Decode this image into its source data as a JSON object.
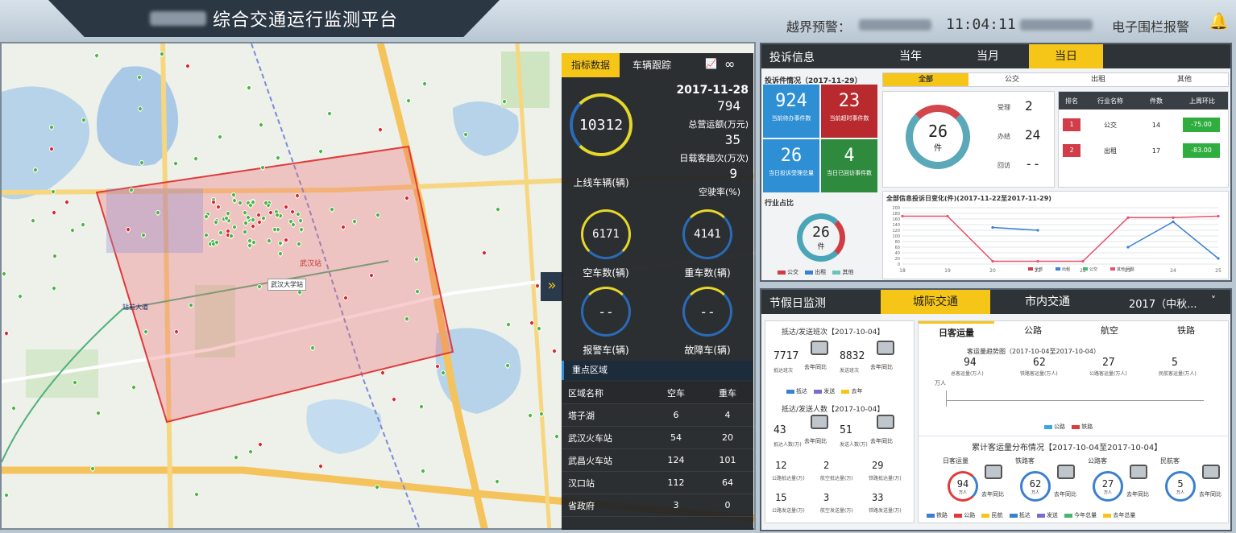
{
  "header": {
    "title": "综合交通运行监测平台",
    "alert_label": "越界预警：",
    "time": "11:04:11",
    "fence_alert": "电子围栏报警"
  },
  "map": {
    "labels": [
      "武汉站",
      "武汉大学站",
      "站前大道",
      "汉口站"
    ],
    "expand_icon": "chevrons-right-icon"
  },
  "overlay": {
    "tabs": [
      "指标数据",
      "车辆跟踪"
    ],
    "date": "2017-11-28",
    "online_vehicles": {
      "value": "10312",
      "label": "上线车辆(辆)"
    },
    "revenue": {
      "value": "794",
      "label": "总营运额(万元)"
    },
    "daily_passengers": {
      "value": "35",
      "label": "日载客趟次(万次)"
    },
    "empty_rate": {
      "value": "9",
      "label": "空驶率(%)"
    },
    "empty_cars": {
      "value": "6171",
      "label": "空车数(辆)"
    },
    "heavy_cars": {
      "value": "4141",
      "label": "重车数(辆)"
    },
    "alarm_cars": {
      "value": "--",
      "label": "报警车(辆)"
    },
    "fault_cars": {
      "value": "--",
      "label": "故障车(辆)"
    },
    "zone_title": "重点区域",
    "zone_headers": [
      "区域名称",
      "空车",
      "重车"
    ],
    "zones": [
      {
        "name": "塔子湖",
        "empty": "6",
        "heavy": "4"
      },
      {
        "name": "武汉火车站",
        "empty": "54",
        "heavy": "20"
      },
      {
        "name": "武昌火车站",
        "empty": "124",
        "heavy": "101"
      },
      {
        "name": "汉口站",
        "empty": "112",
        "heavy": "64"
      },
      {
        "name": "省政府",
        "empty": "3",
        "heavy": "0"
      }
    ]
  },
  "complaints": {
    "title": "投诉信息",
    "period_tabs": [
      "当年",
      "当月",
      "当日"
    ],
    "summary_title": "投诉件情况（2017-11-29）",
    "tiles": [
      {
        "value": "924",
        "label": "当前待办事件数",
        "color": "#2e8fd4"
      },
      {
        "value": "23",
        "label": "当前超时事件数",
        "color": "#b92a2e"
      },
      {
        "value": "26",
        "label": "当日投诉受理总量",
        "color": "#2e8fd4"
      },
      {
        "value": "4",
        "label": "当日已回访事件数",
        "color": "#2e8b3e"
      }
    ],
    "filter_tabs": [
      "全部",
      "公交",
      "出租",
      "其他"
    ],
    "ring": {
      "value": "26",
      "unit": "件"
    },
    "counts": [
      {
        "label": "受理",
        "value": "2"
      },
      {
        "label": "办结",
        "value": "24"
      },
      {
        "label": "回访",
        "value": "--"
      }
    ],
    "rank_headers": [
      "排名",
      "行业名称",
      "件数",
      "上周环比"
    ],
    "ranks": [
      {
        "rank": "1",
        "name": "公交",
        "count": "14",
        "change": "-75.00"
      },
      {
        "rank": "2",
        "name": "出租",
        "count": "17",
        "change": "-83.00"
      }
    ],
    "industry_title": "行业占比",
    "industry_ring": {
      "value": "26",
      "unit": "件"
    },
    "industry_legend": [
      "公交",
      "出租",
      "其他"
    ],
    "chart_title": "全部信息投诉日变化(件)(2017-11-22至2017-11-29)",
    "chart_legend": [
      "全部",
      "出租",
      "公交",
      "其他/问题"
    ]
  },
  "chart_data": {
    "type": "line",
    "x": [
      "18",
      "19",
      "20",
      "21",
      "22",
      "23",
      "24",
      "25"
    ],
    "ylim": [
      0,
      200
    ],
    "yticks": [
      "0",
      "20",
      "40",
      "60",
      "80",
      "100",
      "120",
      "140",
      "160",
      "180",
      "200"
    ],
    "series": [
      {
        "name": "全部",
        "color": "#e8506e",
        "values": [
          170,
          170,
          10,
          10,
          10,
          165,
          165,
          170
        ]
      },
      {
        "name": "出租",
        "color": "#3a7fd0",
        "values": [
          null,
          null,
          130,
          120,
          null,
          60,
          150,
          20
        ]
      }
    ]
  },
  "holiday": {
    "title": "节假日监测",
    "tabs": [
      "城际交通",
      "市内交通"
    ],
    "select_value": "2017（中秋...",
    "arrive_title": "抵达/发送班次【2017-10-04】",
    "arrive_vals": [
      {
        "value": "7717",
        "label": "抵达班次"
      },
      {
        "value": "8832",
        "label": "发送班次"
      }
    ],
    "compare_label": "去年同比",
    "legend_a": [
      "抵达",
      "发送",
      "去年"
    ],
    "people_title": "抵达/发送人数【2017-10-04】",
    "people_vals": [
      {
        "value": "43",
        "label": "抵达人数(万)"
      },
      {
        "value": "51",
        "label": "发送人数(万)"
      }
    ],
    "stats_row1": [
      {
        "value": "12",
        "label": "公路抵达量(万)"
      },
      {
        "value": "2",
        "label": "航空抵达量(万)"
      },
      {
        "value": "29",
        "label": "铁路抵达量(万)"
      }
    ],
    "stats_row2": [
      {
        "value": "15",
        "label": "公路发送量(万)"
      },
      {
        "value": "3",
        "label": "航空发送量(万)"
      },
      {
        "value": "33",
        "label": "铁路发送量(万)"
      }
    ],
    "mode_tabs": [
      "日客运量",
      "公路",
      "航空",
      "铁路"
    ],
    "trend_title": "客运量趋势图（2017-10-04至2017-10-04）",
    "trend_vals": [
      {
        "value": "94",
        "label": "总客运量(万人)"
      },
      {
        "value": "62",
        "label": "铁路客运量(万人)"
      },
      {
        "value": "27",
        "label": "公路客运量(万人)"
      },
      {
        "value": "5",
        "label": "民航客运量(万人)"
      }
    ],
    "trend_axis": "万人",
    "trend_legend": [
      "公路",
      "铁路"
    ],
    "dist_title": "累计客运量分布情况【2017-10-04至2017-10-04】",
    "dist_rings": [
      {
        "title": "日客运量",
        "value": "94",
        "unit": "万人"
      },
      {
        "title": "铁路客",
        "value": "62",
        "unit": "万人"
      },
      {
        "title": "公路客",
        "value": "27",
        "unit": "万人"
      },
      {
        "title": "民航客",
        "value": "5",
        "unit": "万人"
      }
    ],
    "dist_legend": [
      "铁路",
      "公路",
      "民航",
      "抵达",
      "发送",
      "今年总量",
      "去年总量"
    ]
  }
}
